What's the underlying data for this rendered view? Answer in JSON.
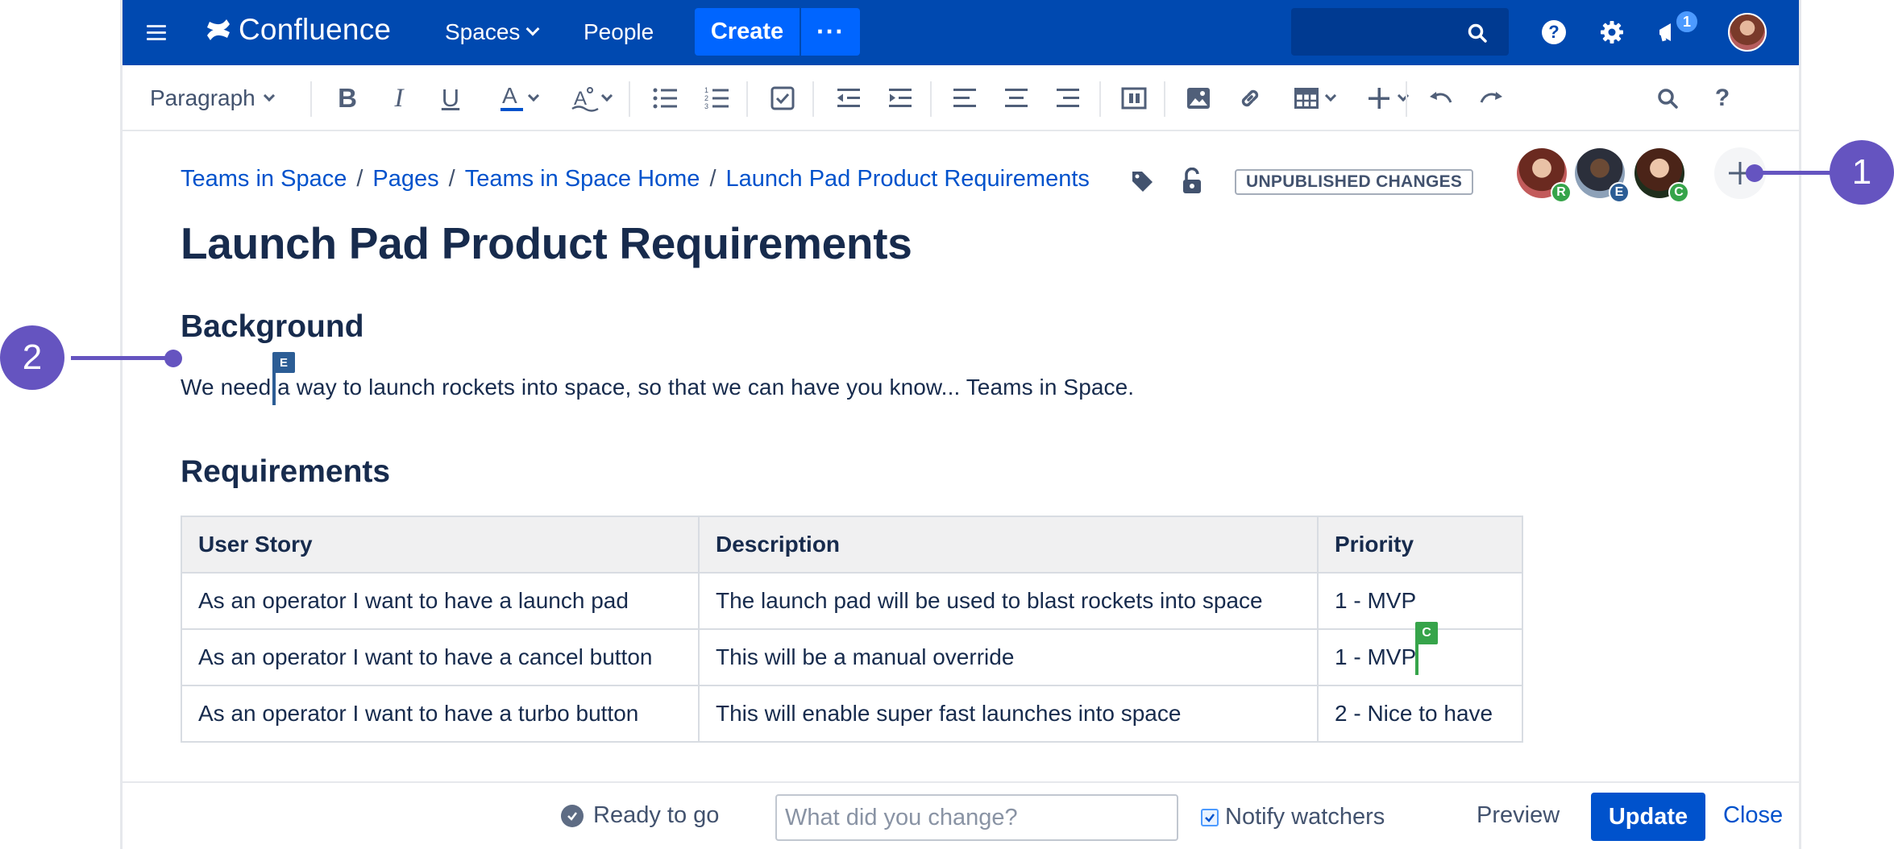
{
  "nav": {
    "logo_text": "Confluence",
    "spaces_label": "Spaces",
    "people_label": "People",
    "create_label": "Create",
    "more_label": "···",
    "notification_count": "1"
  },
  "toolbar": {
    "paragraph_label": "Paragraph"
  },
  "breadcrumbs": [
    "Teams in Space",
    "Pages",
    "Teams in Space Home",
    "Launch Pad Product Requirements"
  ],
  "status_badge": "UNPUBLISHED CHANGES",
  "collaborators": [
    {
      "initial": "R",
      "color": "#36a44a"
    },
    {
      "initial": "E",
      "color": "#2c5d95"
    },
    {
      "initial": "C",
      "color": "#36a44a"
    }
  ],
  "page": {
    "title": "Launch Pad Product Requirements",
    "background_heading": "Background",
    "background_text_before": "We need",
    "background_text_after": " a way to launch rockets into space, so that we can have you know... Teams in Space.",
    "requirements_heading": "Requirements"
  },
  "cursors": {
    "editor_e": "E",
    "editor_c": "C"
  },
  "table": {
    "headers": [
      "User Story",
      "Description",
      "Priority"
    ],
    "rows": [
      [
        "As an operator I want to have a launch pad",
        "The launch pad will be used to blast rockets into space",
        "1 - MVP"
      ],
      [
        "As an operator I want to have a cancel button",
        "This will be a manual override",
        "1 - MVP"
      ],
      [
        "As an operator I want to have a turbo button",
        "This will enable super fast launches into space",
        "2 - Nice to have"
      ]
    ]
  },
  "callouts": [
    "1",
    "2"
  ],
  "bottom": {
    "ready_label": "Ready to go",
    "change_placeholder": "What did you change?",
    "notify_label": "Notify watchers",
    "preview_label": "Preview",
    "update_label": "Update",
    "close_label": "Close"
  },
  "colors": {
    "nav_bg": "#0049b0",
    "primary": "#0052cc",
    "callout": "#6554c0"
  }
}
